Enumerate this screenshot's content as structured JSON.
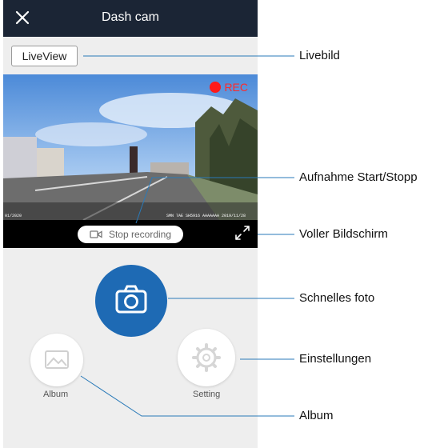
{
  "app": {
    "title": "Dash cam"
  },
  "liveview": {
    "button_label": "LiveView"
  },
  "video": {
    "rec_label": "REC",
    "overlay_left": "01/2020",
    "overlay_right": "SMN  7AE  SH5916  AAAAAAA  2019/11/28"
  },
  "controls": {
    "stop_label": "Stop recording",
    "album_label": "Album",
    "setting_label": "Setting"
  },
  "annotations": {
    "liveview": "Livebild",
    "record": "Aufnahme Start/Stopp",
    "fullscreen": "Voller Bildschirm",
    "photo": "Schnelles foto",
    "settings": "Einstellungen",
    "album": "Album"
  },
  "colors": {
    "header": "#1b2535",
    "accent": "#1e6ab4",
    "rec": "#ff1a1a"
  }
}
